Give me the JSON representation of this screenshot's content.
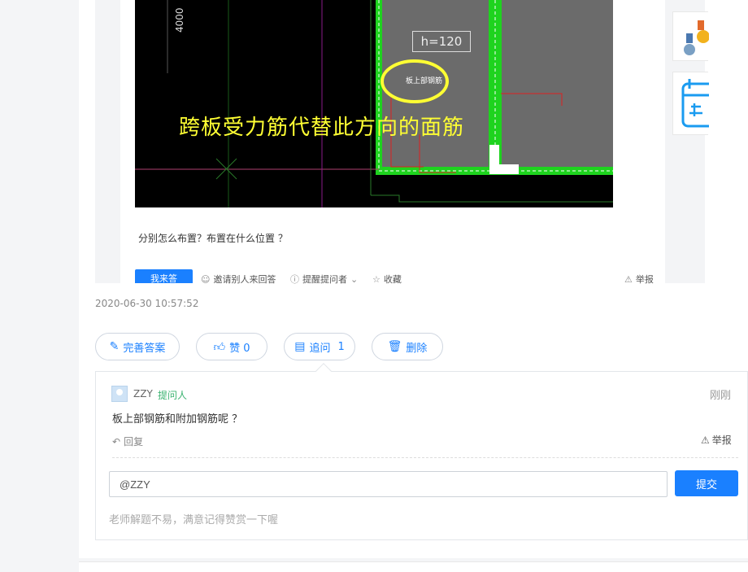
{
  "question": {
    "image": {
      "caption": "跨板受力筋代替此方向的面筋",
      "dim_label": "4000",
      "h_label": "h=120",
      "circled_note": "板上部钢筋"
    },
    "text": "分别怎么布置？布置在什么位置 ？",
    "answer_button": "我来答",
    "actions": {
      "invite": "邀请别人来回答",
      "remind": "提醒提问者",
      "collect": "收藏",
      "report": "举报"
    }
  },
  "answer": {
    "timestamp": "2020-06-30 10:57:52",
    "buttons": {
      "improve": "完善答案",
      "like": "赞 0",
      "followup": "追问",
      "followup_count": "1",
      "delete": "删除"
    }
  },
  "followup": {
    "user": "ZZY",
    "role_tag": "提问人",
    "time": "刚刚",
    "text": "板上部钢筋和附加钢筋呢 ？",
    "reply": "回复",
    "report": "举报",
    "input_value": "@ZZY",
    "submit": "提交",
    "hint": "老师解题不易，满意记得赞赏一下喔"
  },
  "colors": {
    "accent": "#1a80ff",
    "tag_green": "#3cb371",
    "cad_highlight": "#ffff33"
  }
}
